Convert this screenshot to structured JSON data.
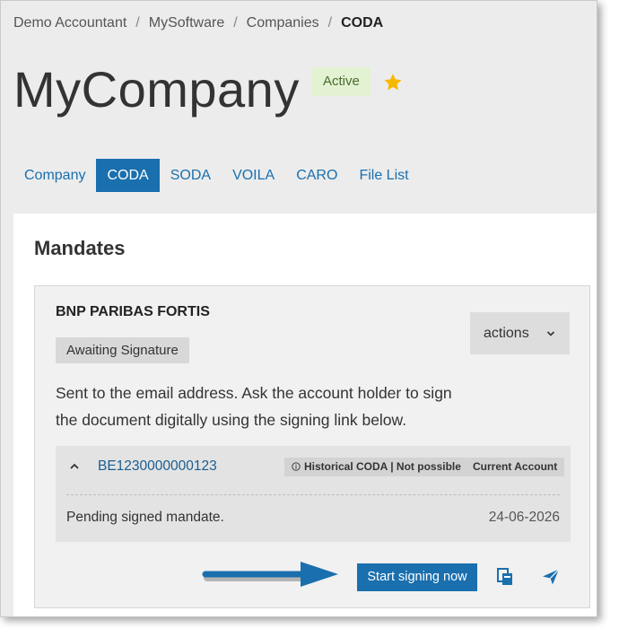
{
  "breadcrumb": {
    "items": [
      "Demo Accountant",
      "MySoftware",
      "Companies"
    ],
    "current": "CODA",
    "separator": "/"
  },
  "page": {
    "title": "MyCompany",
    "status": "Active",
    "favorite": true
  },
  "tabs": [
    {
      "label": "Company",
      "active": false
    },
    {
      "label": "CODA",
      "active": true
    },
    {
      "label": "SODA",
      "active": false
    },
    {
      "label": "VOILA",
      "active": false
    },
    {
      "label": "CARO",
      "active": false
    },
    {
      "label": "File List",
      "active": false
    }
  ],
  "mandates": {
    "title": "Mandates",
    "card": {
      "bank": "BNP PARIBAS FORTIS",
      "status": "Awaiting Signature",
      "actions_label": "actions",
      "description_line1": "Sent to the email address. Ask the account holder to sign",
      "description_line2": "the document digitally using the signing link below.",
      "account": {
        "iban": "BE1230000000123",
        "tag_historical": "Historical CODA | Not possible",
        "tag_current": "Current Account",
        "pending_text": "Pending signed mandate.",
        "date": "24-06-2026"
      },
      "start_signing_label": "Start signing now"
    }
  },
  "icons": {
    "favorite": "star-icon",
    "dropdown": "chevron-down-icon",
    "collapse": "chevron-up-icon",
    "info": "info-icon",
    "copy": "copy-icon",
    "send": "send-icon",
    "pointer": "arrow-right-icon"
  },
  "colors": {
    "primary": "#1a6fae",
    "active_badge_bg": "#e2f2d2",
    "star": "#f5b800",
    "frame_bg": "#ececec"
  }
}
